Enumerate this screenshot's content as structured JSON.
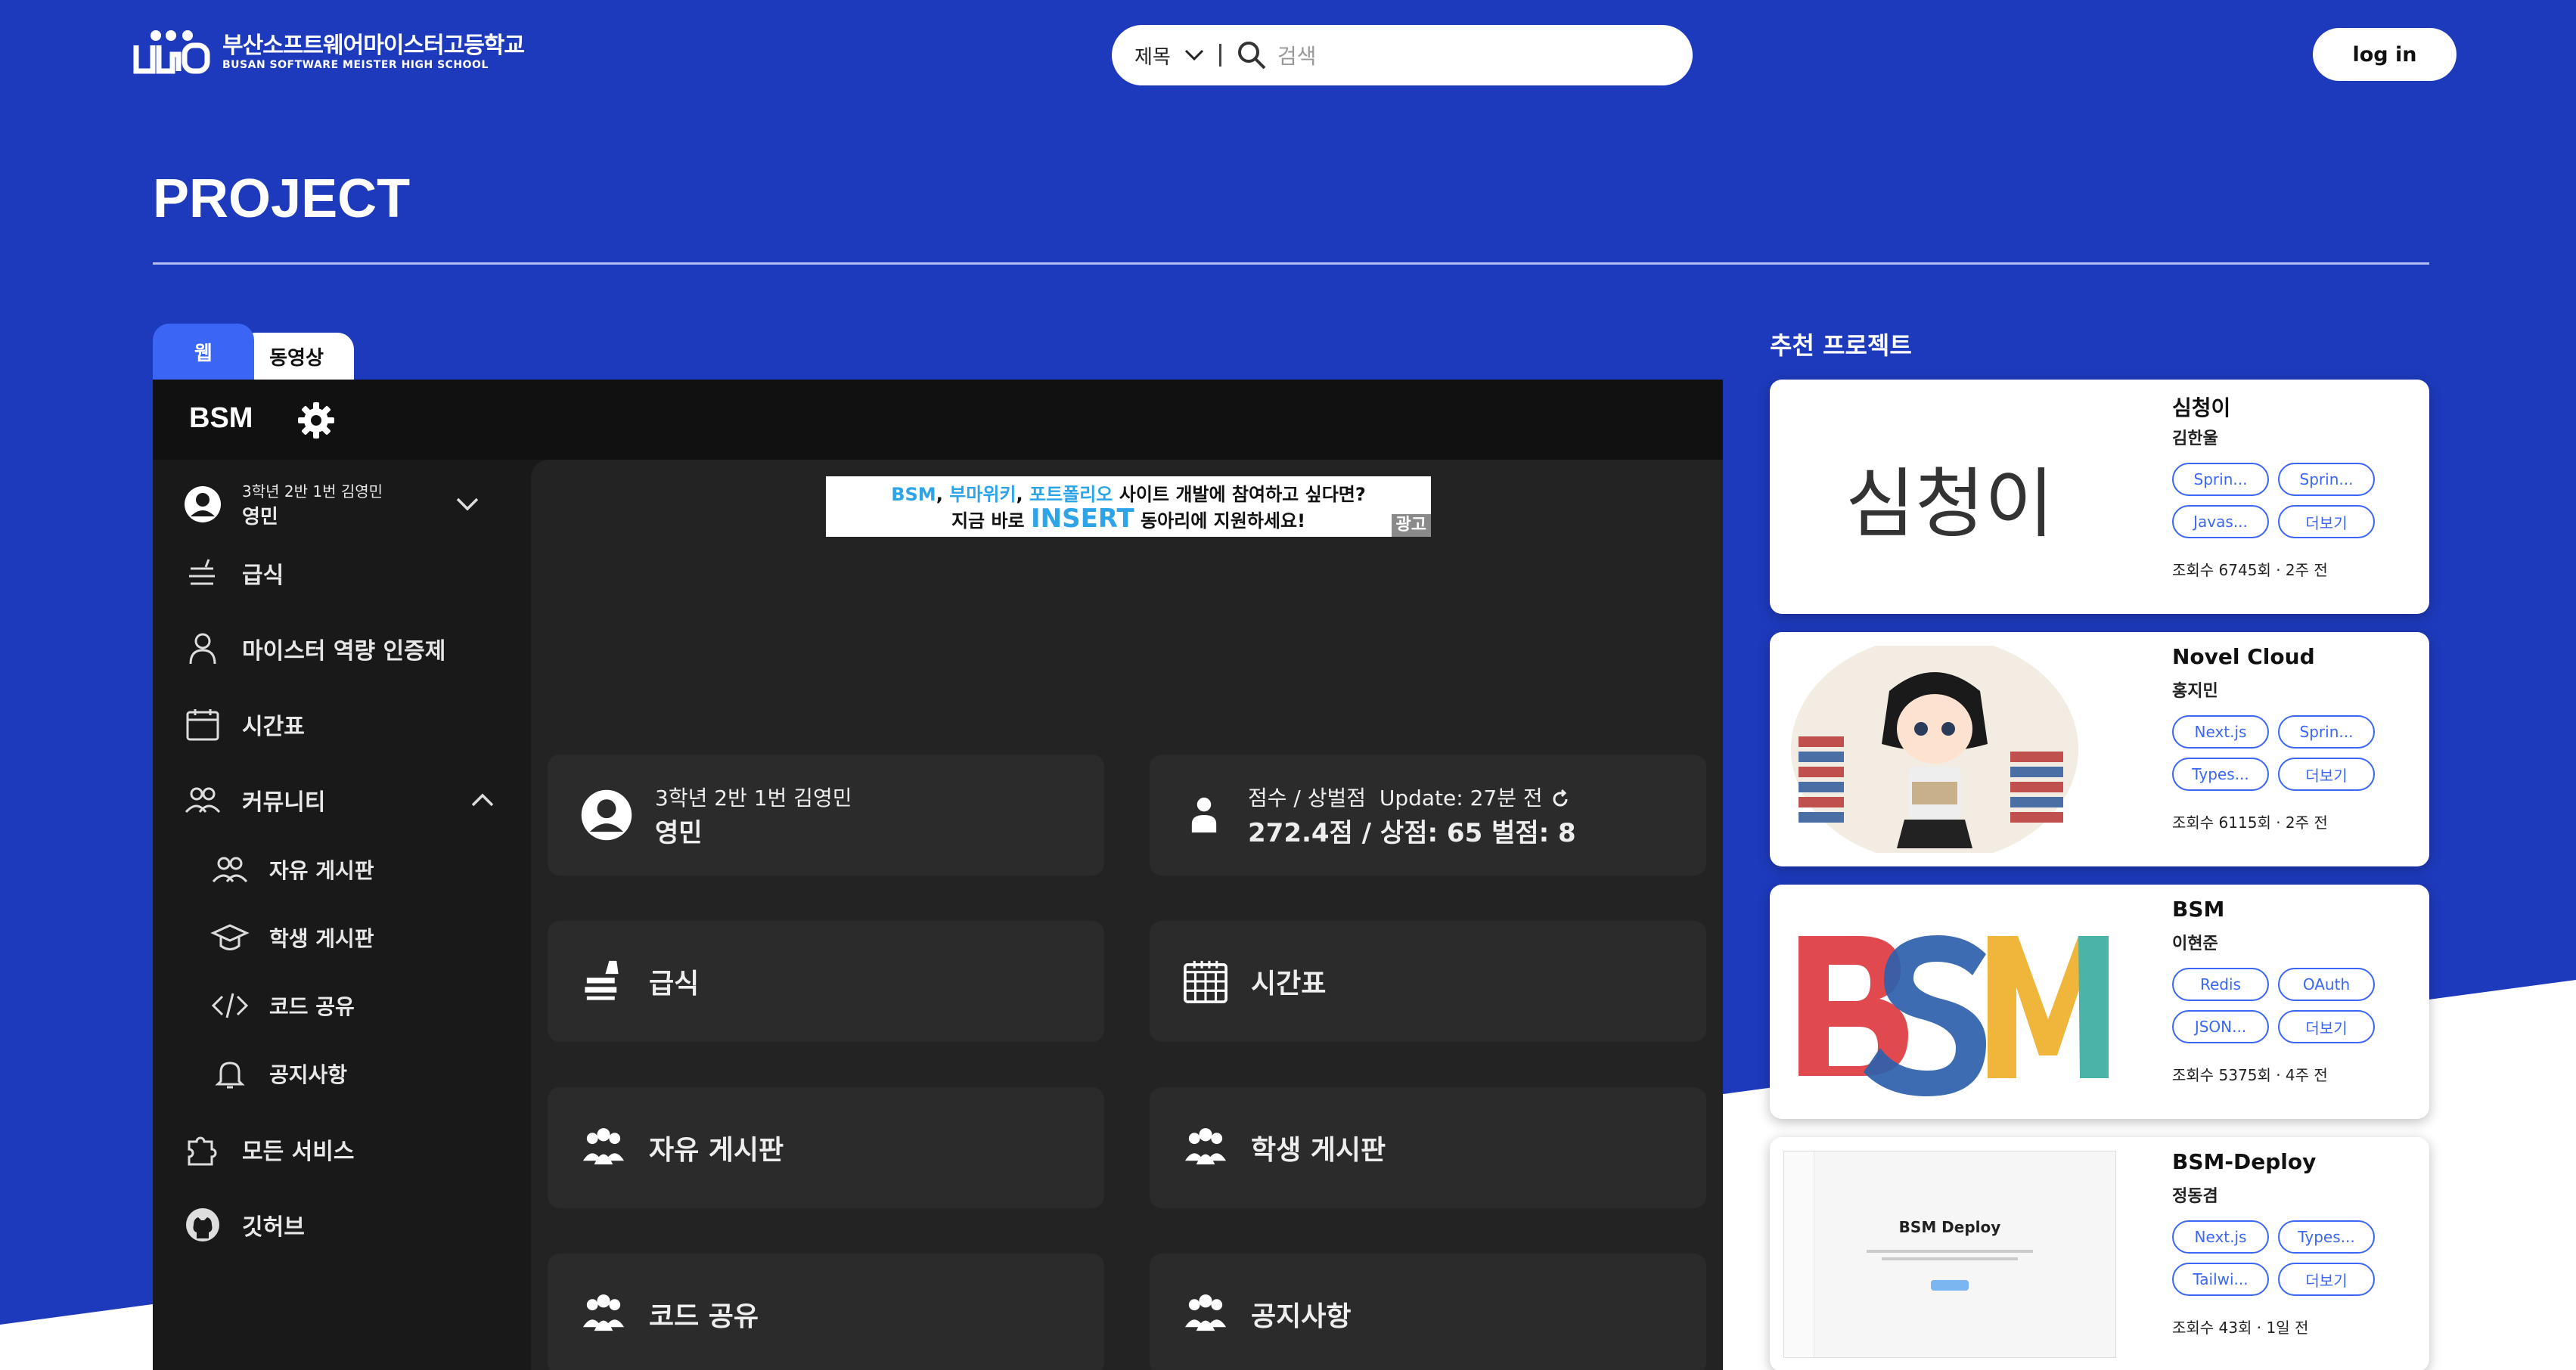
{
  "header": {
    "logo_ko": "부산소프트웨어마이스터고등학교",
    "logo_en": "BUSAN SOFTWARE MEISTER HIGH SCHOOL",
    "search": {
      "select_value": "제목",
      "placeholder": "검색"
    },
    "login_label": "log in"
  },
  "page_title": "PROJECT",
  "tabs": [
    {
      "label": "웹"
    },
    {
      "label": "동영상"
    }
  ],
  "app": {
    "brand": "BSM",
    "user": {
      "class_info": "3학년 2반 1번 김영민",
      "name": "영민"
    },
    "sidebar": {
      "meal": "급식",
      "meister": "마이스터 역량 인증제",
      "timetable": "시간표",
      "community": "커뮤니티",
      "free_board": "자유 게시판",
      "student_board": "학생 게시판",
      "code_share": "코드 공유",
      "notice": "공지사항",
      "all_services": "모든 서비스",
      "github": "깃허브"
    },
    "ad": {
      "line1_a": "BSM",
      "line1_b": ", ",
      "line1_c": "부마위키",
      "line1_d": ", ",
      "line1_e": "포트폴리오",
      "line1_f": " 사이트 개발에 참여하고 싶다면?",
      "line2_a": "지금 바로 ",
      "line2_b": "INSERT",
      "line2_c": " 동아리에 지원하세요!",
      "tag": "광고"
    },
    "cards": {
      "profile_class": "3학년 2반 1번 김영민",
      "profile_name": "영민",
      "score_label": "점수 / 상벌점",
      "score_update": "Update: 27분 전",
      "score_value": "272.4점 / 상점: 65 벌점: 8",
      "meal": "급식",
      "timetable": "시간표",
      "free_board": "자유 게시판",
      "student_board": "학생 게시판",
      "code_share": "코드 공유",
      "notice": "공지사항"
    }
  },
  "recommended": {
    "title": "추천 프로젝트",
    "projects": [
      {
        "name": "심청이",
        "author": "김한울",
        "thumb_text": "심청이",
        "tags": [
          "Sprin...",
          "Sprin...",
          "Javas...",
          "더보기"
        ],
        "meta": "조회수 6745회 · 2주 전"
      },
      {
        "name": "Novel Cloud",
        "author": "홍지민",
        "tags": [
          "Next.js",
          "Sprin...",
          "Types...",
          "더보기"
        ],
        "meta": "조회수 6115회 · 2주 전"
      },
      {
        "name": "BSM",
        "author": "이현준",
        "thumb_text": "BSM",
        "tags": [
          "Redis",
          "OAuth",
          "JSON...",
          "더보기"
        ],
        "meta": "조회수 5375회 · 4주 전"
      },
      {
        "name": "BSM-Deploy",
        "author": "정동겸",
        "thumb_text": "BSM Deploy",
        "tags": [
          "Next.js",
          "Types...",
          "Tailwi...",
          "더보기"
        ],
        "meta": "조회수 43회 · 1일 전"
      }
    ]
  },
  "colors": {
    "background": "#1e3abc",
    "accent": "#3b66f5",
    "dark": "#191919"
  }
}
